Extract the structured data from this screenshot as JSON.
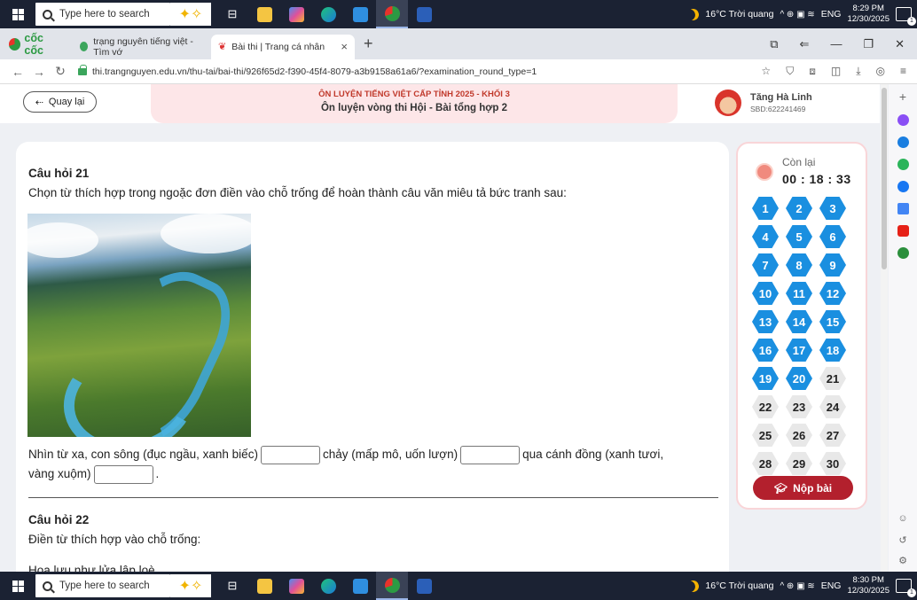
{
  "taskbar_top": {
    "search_placeholder": "Type here to search",
    "weather": "16°C  Trời quang",
    "lang": "ENG",
    "time": "8:29 PM",
    "date": "12/30/2025"
  },
  "taskbar_bottom": {
    "search_placeholder": "Type here to search",
    "weather": "16°C  Trời quang",
    "lang": "ENG",
    "time": "8:30 PM",
    "date": "12/30/2025"
  },
  "browser": {
    "brand": "cốc cốc",
    "tabs": [
      {
        "label": "trạng nguyên tiếng việt - Tìm vớ"
      },
      {
        "label": "Bài thi | Trang cá nhân"
      }
    ],
    "url": "thi.trangnguyen.edu.vn/thu-tai/bai-thi/926f65d2-f390-45f4-8079-a3b9158a61a6/?examination_round_type=1"
  },
  "header": {
    "back_label": "Quay lại",
    "exam_title": "ÔN LUYỆN TIẾNG VIỆT CẤP TỈNH 2025 - KHỐI 3",
    "exam_subtitle": "Ôn luyện vòng thi Hội - Bài tổng hợp 2",
    "user_name": "Tăng Hà Linh",
    "user_sbd": "SBD:622241469"
  },
  "question21": {
    "title": "Câu hỏi 21",
    "prompt": "Chọn từ thích hợp trong ngoặc đơn điền vào chỗ trống để hoàn thành câu văn miêu tả bức tranh sau:",
    "part1": "Nhìn từ xa, con sông (đục ngầu, xanh biếc)",
    "part2": "chảy (mấp mô, uốn lượn)",
    "part3": "qua cánh đồng (xanh tươi,",
    "part4": "vàng xuộm)",
    "end": "."
  },
  "question22": {
    "title": "Câu hỏi 22",
    "prompt": "Điền từ thích hợp vào chỗ trống:",
    "line1": "Hoa lựu như lửa lập loè"
  },
  "sidepanel": {
    "remaining_label": "Còn lại",
    "time_left": "00 : 18 : 33",
    "questions_done": [
      "1",
      "2",
      "3",
      "4",
      "5",
      "6",
      "7",
      "8",
      "9",
      "10",
      "11",
      "12",
      "13",
      "14",
      "15",
      "16",
      "17",
      "18",
      "19",
      "20"
    ],
    "questions_todo": [
      "21",
      "22",
      "23",
      "24",
      "25",
      "26",
      "27",
      "28",
      "29",
      "30"
    ],
    "submit_label": "Nộp bài"
  }
}
